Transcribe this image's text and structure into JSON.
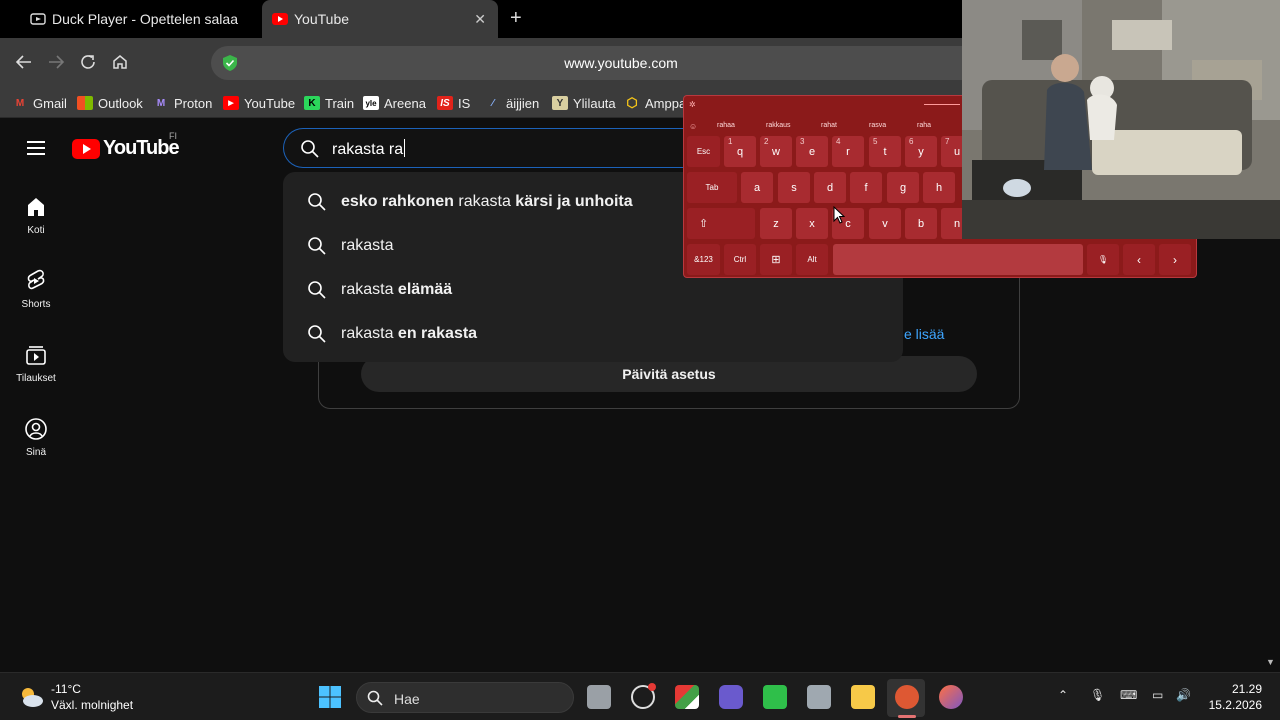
{
  "browser": {
    "tabs": [
      {
        "label": "Duck Player - Opettelen salaa"
      },
      {
        "label": "YouTube"
      }
    ],
    "url": "www.youtube.com",
    "bookmarks": [
      {
        "label": "Gmail"
      },
      {
        "label": "Outlook"
      },
      {
        "label": "Proton"
      },
      {
        "label": "YouTube"
      },
      {
        "label": "Train"
      },
      {
        "label": "Areena"
      },
      {
        "label": "IS"
      },
      {
        "label": "äijjien"
      },
      {
        "label": "Ylilauta"
      },
      {
        "label": "Amppa"
      }
    ]
  },
  "youtube": {
    "logo_text": "YouTube",
    "country_code": "FI",
    "sidebar": [
      {
        "label": "Koti",
        "icon": "home-icon"
      },
      {
        "label": "Shorts",
        "icon": "shorts-icon"
      },
      {
        "label": "Tilaukset",
        "icon": "subscriptions-icon"
      },
      {
        "label": "Sinä",
        "icon": "account-icon"
      }
    ],
    "search": {
      "value": "rakasta ra"
    },
    "suggestions": [
      {
        "pre": "esko rahkonen ",
        "typed": "rakasta",
        "post": " kärsi ja unhoita"
      },
      {
        "pre": "",
        "typed": "rakasta",
        "post": ""
      },
      {
        "pre": "",
        "typed": "rakasta",
        "post": " elämää"
      },
      {
        "pre": "",
        "typed": "rakasta",
        "post": " en rakasta"
      }
    ],
    "card": {
      "more_link": "e lisää",
      "update_button": "Päivitä asetus"
    }
  },
  "keyboard": {
    "predictions": [
      "rahaa",
      "rakkaus",
      "rahat",
      "rasva",
      "raha"
    ],
    "row1": [
      {
        "k": "Esc",
        "n": ""
      },
      {
        "k": "q",
        "n": "1"
      },
      {
        "k": "w",
        "n": "2"
      },
      {
        "k": "e",
        "n": "3"
      },
      {
        "k": "r",
        "n": "4"
      },
      {
        "k": "t",
        "n": "5"
      },
      {
        "k": "y",
        "n": "6"
      },
      {
        "k": "u",
        "n": "7"
      }
    ],
    "row2": [
      "Tab",
      "a",
      "s",
      "d",
      "f",
      "g",
      "h"
    ],
    "row3": [
      "⇧",
      "z",
      "x",
      "c",
      "v",
      "b",
      "n"
    ],
    "row4": [
      "&123",
      "Ctrl",
      "⊞",
      "Alt",
      "",
      "🎙",
      "‹",
      "›"
    ]
  },
  "taskbar": {
    "temperature": "-11°C",
    "weather": "Växl. molnighet",
    "search_placeholder": "Hae",
    "time": "21.29",
    "date": "15.2.2026"
  },
  "colors": {
    "yt_red": "#ff0000",
    "keyboard_bg": "#8b1a1a",
    "link_blue": "#3ea6ff",
    "focus_blue": "#1c62b9"
  }
}
